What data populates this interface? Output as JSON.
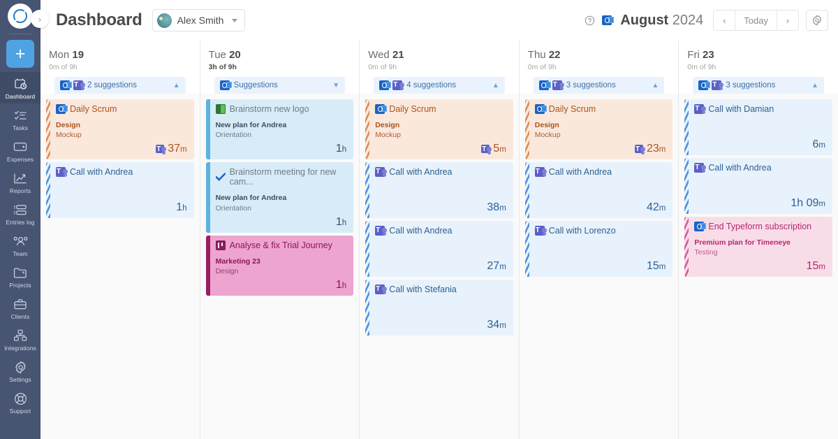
{
  "sidebar": {
    "logo": "timer-logo",
    "add_label": "+",
    "items": [
      {
        "label": "Dashboard",
        "icon": "dashboard-icon",
        "active": true
      },
      {
        "label": "Tasks",
        "icon": "tasks-icon",
        "active": false
      },
      {
        "label": "Expenses",
        "icon": "expenses-icon",
        "active": false
      },
      {
        "label": "Reports",
        "icon": "reports-icon",
        "active": false
      },
      {
        "label": "Entries log",
        "icon": "entries-log-icon",
        "active": false
      },
      {
        "label": "Team",
        "icon": "team-icon",
        "active": false
      },
      {
        "label": "Projects",
        "icon": "projects-icon",
        "active": false
      },
      {
        "label": "Clients",
        "icon": "clients-icon",
        "active": false
      },
      {
        "label": "Integrations",
        "icon": "integrations-icon",
        "active": false
      },
      {
        "label": "Settings",
        "icon": "settings-icon",
        "active": false
      },
      {
        "label": "Support",
        "icon": "support-icon",
        "active": false
      }
    ]
  },
  "header": {
    "title": "Dashboard",
    "user": "Alex Smith",
    "month": "August",
    "year": "2024",
    "today_label": "Today",
    "prev_label": "‹",
    "next_label": "›",
    "help_icon": "help-icon",
    "outlook_icon": "outlook-icon",
    "gear_icon": "gear-icon"
  },
  "days": [
    {
      "weekday": "Mon",
      "daynum": "19",
      "tracked": "0m",
      "of": "of",
      "goal": "9h",
      "filled": false,
      "suggestions": "2 suggestions",
      "suggestion_icons": [
        "outlook-icon",
        "teams-icon"
      ],
      "expanded": true,
      "cards": [
        {
          "title": "Daily Scrum",
          "icon": "outlook-icon",
          "scheme": "c-orange",
          "border": "dashed",
          "project": "Design",
          "task": "Mockup",
          "duration_value": "37",
          "duration_unit": "m",
          "duration_icon": "teams-icon"
        },
        {
          "title": "Call with Andrea",
          "icon": "teams-icon",
          "scheme": "c-blue",
          "border": "dashed",
          "project": "",
          "task": "",
          "duration_value": "1",
          "duration_unit": "h",
          "duration_icon": ""
        }
      ]
    },
    {
      "weekday": "Tue",
      "daynum": "20",
      "tracked": "3h",
      "of": "of",
      "goal": "9h",
      "filled": true,
      "suggestions": "Suggestions",
      "suggestion_icons": [
        "outlook-icon"
      ],
      "expanded": false,
      "cards": [
        {
          "title": "Brainstorm new logo",
          "icon": "planner-icon",
          "scheme": "c-lightblue",
          "border": "solid",
          "project": "New plan for Andrea",
          "task": "Orientation",
          "duration_value": "1",
          "duration_unit": "h",
          "duration_icon": ""
        },
        {
          "title": "Brainstorm meeting for new cam...",
          "icon": "todo-icon",
          "scheme": "c-lightblue",
          "border": "solid",
          "project": "New plan for Andrea",
          "task": "Orientation",
          "duration_value": "1",
          "duration_unit": "h",
          "duration_icon": ""
        },
        {
          "title": "Analyse & fix Trial Journey",
          "icon": "jira-icon",
          "scheme": "c-pink",
          "border": "solid",
          "project": "Marketing 23",
          "task": "Design",
          "duration_value": "1",
          "duration_unit": "h",
          "duration_icon": ""
        }
      ]
    },
    {
      "weekday": "Wed",
      "daynum": "21",
      "tracked": "0m",
      "of": "of",
      "goal": "9h",
      "filled": false,
      "suggestions": "4 suggestions",
      "suggestion_icons": [
        "outlook-icon",
        "teams-icon"
      ],
      "expanded": true,
      "cards": [
        {
          "title": "Daily Scrum",
          "icon": "outlook-icon",
          "scheme": "c-orange",
          "border": "dashed",
          "project": "Design",
          "task": "Mockup",
          "duration_value": "5",
          "duration_unit": "m",
          "duration_icon": "teams-icon"
        },
        {
          "title": "Call with Andrea",
          "icon": "teams-icon",
          "scheme": "c-blue",
          "border": "dashed",
          "project": "",
          "task": "",
          "duration_value": "38",
          "duration_unit": "m",
          "duration_icon": ""
        },
        {
          "title": "Call with Andrea",
          "icon": "teams-icon",
          "scheme": "c-blue",
          "border": "dashed",
          "project": "",
          "task": "",
          "duration_value": "27",
          "duration_unit": "m",
          "duration_icon": ""
        },
        {
          "title": "Call with Stefania",
          "icon": "teams-icon",
          "scheme": "c-blue",
          "border": "dashed",
          "project": "",
          "task": "",
          "duration_value": "34",
          "duration_unit": "m",
          "duration_icon": ""
        }
      ]
    },
    {
      "weekday": "Thu",
      "daynum": "22",
      "tracked": "0m",
      "of": "of",
      "goal": "9h",
      "filled": false,
      "suggestions": "3 suggestions",
      "suggestion_icons": [
        "outlook-icon",
        "teams-icon"
      ],
      "expanded": true,
      "cards": [
        {
          "title": "Daily Scrum",
          "icon": "outlook-icon",
          "scheme": "c-orange",
          "border": "dashed",
          "project": "Design",
          "task": "Mockup",
          "duration_value": "23",
          "duration_unit": "m",
          "duration_icon": "teams-icon"
        },
        {
          "title": "Call with Andrea",
          "icon": "teams-icon",
          "scheme": "c-blue",
          "border": "dashed",
          "project": "",
          "task": "",
          "duration_value": "42",
          "duration_unit": "m",
          "duration_icon": ""
        },
        {
          "title": "Call with Lorenzo",
          "icon": "teams-icon",
          "scheme": "c-blue",
          "border": "dashed",
          "project": "",
          "task": "",
          "duration_value": "15",
          "duration_unit": "m",
          "duration_icon": ""
        }
      ]
    },
    {
      "weekday": "Fri",
      "daynum": "23",
      "tracked": "0m",
      "of": "of",
      "goal": "9h",
      "filled": false,
      "suggestions": "3 suggestions",
      "suggestion_icons": [
        "outlook-icon",
        "teams-icon"
      ],
      "expanded": true,
      "cards": [
        {
          "title": "Call with Damian",
          "icon": "teams-icon",
          "scheme": "c-blue",
          "border": "dashed",
          "project": "",
          "task": "",
          "duration_value": "6",
          "duration_unit": "m",
          "duration_icon": ""
        },
        {
          "title": "Call with Andrea",
          "icon": "teams-icon",
          "scheme": "c-blue",
          "border": "dashed",
          "project": "",
          "task": "",
          "duration_value": "1h 09",
          "duration_unit": "m",
          "duration_icon": ""
        },
        {
          "title": "End Typeform subscription",
          "icon": "outlook-icon",
          "scheme": "c-softpink",
          "border": "dashed",
          "project": "Premium plan for Timeneye",
          "task": "Testing",
          "duration_value": "15",
          "duration_unit": "m",
          "duration_icon": ""
        }
      ]
    }
  ],
  "colors": {
    "sidebar_bg": "#475573",
    "accent_blue": "#4fa3e3",
    "orange_card": "#fbe8dc",
    "blue_card": "#e8f2fc",
    "lightblue_card": "#d8ecf8",
    "pink_card": "#eda4ce",
    "softpink_card": "#f8dde9"
  }
}
